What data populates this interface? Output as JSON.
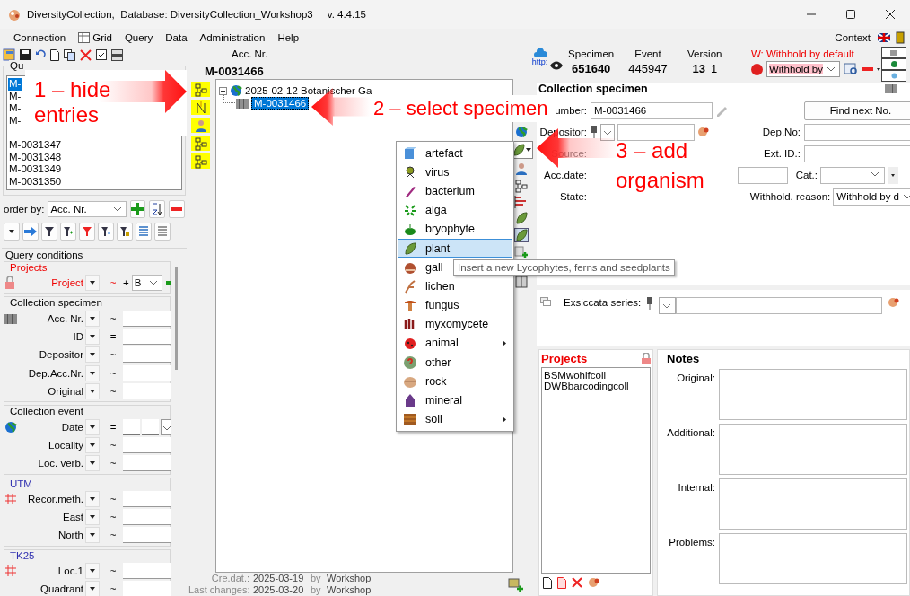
{
  "window": {
    "title": "DiversityCollection,  Database: DiversityCollection_Workshop3",
    "version": "v. 4.4.15"
  },
  "menu": [
    {
      "label": "Connection",
      "kind": "plain"
    },
    {
      "label": "Grid",
      "kind": "icon"
    },
    {
      "label": "Query",
      "kind": "plain"
    },
    {
      "label": "Data",
      "kind": "plain"
    },
    {
      "label": "Administration",
      "kind": "plain"
    },
    {
      "label": "Help",
      "kind": "plain"
    }
  ],
  "context_label": "Context",
  "query_results": {
    "label": "Qu",
    "items": [
      {
        "text": "M-",
        "selected": true
      },
      {
        "text": "M-",
        "selected": false
      },
      {
        "text": "M-",
        "selected": false
      },
      {
        "text": "M-",
        "selected": false
      },
      {
        "text": "M-0031347",
        "selected": false
      },
      {
        "text": "M-0031348",
        "selected": false
      },
      {
        "text": "M-0031349",
        "selected": false
      },
      {
        "text": "M-0031350",
        "selected": false
      }
    ]
  },
  "order_by": {
    "label": "order by:",
    "value": "Acc. Nr."
  },
  "query_conditions": {
    "title": "Query conditions",
    "groups": [
      {
        "title": "Projects",
        "kind": "restricted",
        "rows": [
          {
            "label": "Project",
            "operator": "~",
            "kind": "project",
            "extra": "+",
            "value": "B"
          }
        ]
      },
      {
        "title": "Collection specimen",
        "kind": "plain",
        "rows": [
          {
            "label": "Acc. Nr.",
            "operator": "~",
            "kind": "text"
          },
          {
            "label": "ID",
            "operator": "=",
            "kind": "text"
          },
          {
            "label": "Depositor",
            "operator": "~",
            "kind": "text"
          },
          {
            "label": "Dep.Acc.Nr.",
            "operator": "~",
            "kind": "text"
          },
          {
            "label": "Original",
            "operator": "~",
            "kind": "text"
          }
        ]
      },
      {
        "title": "Collection event",
        "kind": "plain",
        "rows": [
          {
            "label": "Date",
            "operator": "=",
            "kind": "date"
          },
          {
            "label": "Locality",
            "operator": "~",
            "kind": "text"
          },
          {
            "label": "Loc. verb.",
            "operator": "~",
            "kind": "text"
          }
        ]
      },
      {
        "title": "UTM",
        "kind": "spatial",
        "rows": [
          {
            "label": "Recor.meth.",
            "operator": "~",
            "kind": "text"
          },
          {
            "label": "East",
            "operator": "~",
            "kind": "text"
          },
          {
            "label": "North",
            "operator": "~",
            "kind": "text"
          }
        ]
      },
      {
        "title": "TK25",
        "kind": "spatial",
        "rows": [
          {
            "label": "Loc.1",
            "operator": "~",
            "kind": "text"
          },
          {
            "label": "Quadrant",
            "operator": "~",
            "kind": "text"
          }
        ]
      }
    ]
  },
  "record": {
    "acc_label": "Acc. Nr.",
    "acc_value": "M-0031466"
  },
  "tree": [
    {
      "text": "2025-02-12 Botanischer Ga",
      "expanded": true,
      "children": [
        {
          "text": "M-0031466",
          "selected": true
        }
      ]
    }
  ],
  "add_menu": {
    "items": [
      {
        "label": "artefact",
        "selected": false,
        "submenu": false
      },
      {
        "label": "virus",
        "selected": false,
        "submenu": false
      },
      {
        "label": "bacterium",
        "selected": false,
        "submenu": false
      },
      {
        "label": "alga",
        "selected": false,
        "submenu": false
      },
      {
        "label": "bryophyte",
        "selected": false,
        "submenu": false
      },
      {
        "label": "plant",
        "selected": true,
        "submenu": false
      },
      {
        "label": "gall",
        "selected": false,
        "submenu": false
      },
      {
        "label": "lichen",
        "selected": false,
        "submenu": false
      },
      {
        "label": "fungus",
        "selected": false,
        "submenu": false
      },
      {
        "label": "myxomycete",
        "selected": false,
        "submenu": false
      },
      {
        "label": "animal",
        "selected": false,
        "submenu": true
      },
      {
        "label": "other",
        "selected": false,
        "submenu": false
      },
      {
        "label": "rock",
        "selected": false,
        "submenu": false
      },
      {
        "label": "mineral",
        "selected": false,
        "submenu": false
      },
      {
        "label": "soil",
        "selected": false,
        "submenu": true
      }
    ]
  },
  "tooltip": "Insert a new Lycophytes, ferns and seedplants",
  "footer": [
    {
      "label": "Cre.dat.:",
      "date": "2025-03-19",
      "by": "by",
      "user": "Workshop"
    },
    {
      "label": "Last changes:",
      "date": "2025-03-20",
      "by": "by",
      "user": "Workshop"
    }
  ],
  "ids": {
    "link": "http:",
    "columns": [
      {
        "label": "Specimen",
        "value": "651640",
        "emphasis": true
      },
      {
        "label": "Event",
        "value": "445947",
        "emphasis": false
      },
      {
        "label": "Version",
        "value": "13",
        "emphasis": true,
        "sub": "1"
      }
    ]
  },
  "withhold": {
    "warning": "W: Withhold by default",
    "value": "Withhold by"
  },
  "specimen": {
    "title": "Collection specimen",
    "number_label": "umber:",
    "number": "M-0031466",
    "find_button": "Find next No.",
    "depositor_label": "Depositor:",
    "dep_no_label": "Dep.No:",
    "source": {
      "label": "Source:",
      "disabled": true
    },
    "ext_id_label": "Ext. ID.:",
    "acc_date_label": "Acc.date:",
    "cat_label": "Cat.:",
    "state_label": "State:",
    "withhold_reason_label": "Withhold. reason:",
    "withhold_reason": "Withhold by d"
  },
  "exsiccata": {
    "label": "Exsiccata series:"
  },
  "projects": {
    "title": "Projects",
    "items": [
      "BSMwohlfcoll",
      "DWBbarcodingcoll"
    ]
  },
  "notes": {
    "title": "Notes",
    "fields": [
      {
        "label": "Original:"
      },
      {
        "label": "Additional:"
      },
      {
        "label": "Internal:"
      },
      {
        "label": "Problems:"
      }
    ]
  },
  "annotations": [
    {
      "text": "1 – hide entries",
      "kind": "point-right"
    },
    {
      "text": "2 – select specimen",
      "kind": "point-left"
    },
    {
      "text": "3 – add organism",
      "kind": "point-left"
    }
  ]
}
